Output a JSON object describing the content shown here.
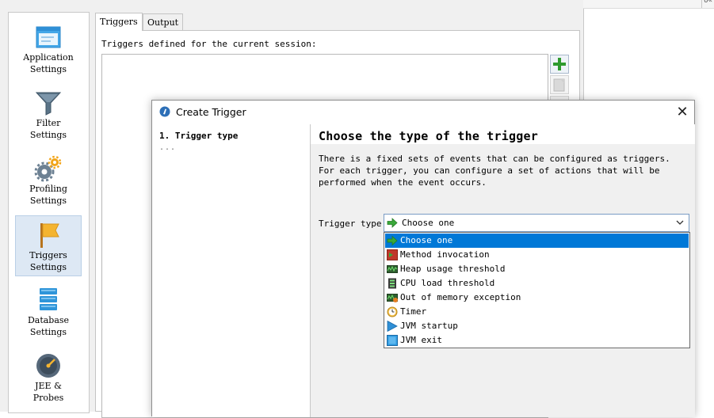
{
  "sidebar": {
    "items": [
      {
        "label": "Application\nSettings",
        "icon": "application-settings-icon"
      },
      {
        "label": "Filter\nSettings",
        "icon": "funnel-icon"
      },
      {
        "label": "Profiling\nSettings",
        "icon": "gears-icon"
      },
      {
        "label": "Triggers\nSettings",
        "icon": "flag-icon",
        "selected": true
      },
      {
        "label": "Database\nSettings",
        "icon": "database-icon"
      },
      {
        "label": "JEE &\nProbes",
        "icon": "gauge-icon"
      }
    ]
  },
  "tabs": [
    {
      "label": "Triggers",
      "active": true
    },
    {
      "label": "Output",
      "active": false
    }
  ],
  "triggers_panel": {
    "caption": "Triggers defined for the current session:",
    "buttons": [
      "add-icon",
      "edit-icon",
      "delete-icon"
    ]
  },
  "dialog": {
    "title": "Create Trigger",
    "close_glyph": "✕",
    "steps": {
      "current": "1. Trigger type",
      "more": "..."
    },
    "heading": "Choose the type of the trigger",
    "description": "There is a fixed sets of events that can be configured as triggers. For each trigger, you can configure a set of actions that will be performed when the event occurs.",
    "trigger_type": {
      "label": "Trigger type:",
      "selected": "Choose one",
      "options": [
        {
          "label": "Choose one",
          "icon": "green-arrow-icon"
        },
        {
          "label": "Method invocation",
          "icon": "method-invocation-icon"
        },
        {
          "label": "Heap usage threshold",
          "icon": "heap-icon"
        },
        {
          "label": "CPU load threshold",
          "icon": "cpu-icon"
        },
        {
          "label": "Out of memory exception",
          "icon": "out-of-memory-icon"
        },
        {
          "label": "Timer",
          "icon": "timer-icon"
        },
        {
          "label": "JVM startup",
          "icon": "jvm-startup-icon"
        },
        {
          "label": "JVM exit",
          "icon": "jvm-exit-icon"
        }
      ]
    }
  },
  "colors": {
    "selection": "#0078d7",
    "sidebar_selected": "#dde8f4",
    "panel_bg": "#f0f0f0",
    "accent_green": "#3aa83a"
  }
}
